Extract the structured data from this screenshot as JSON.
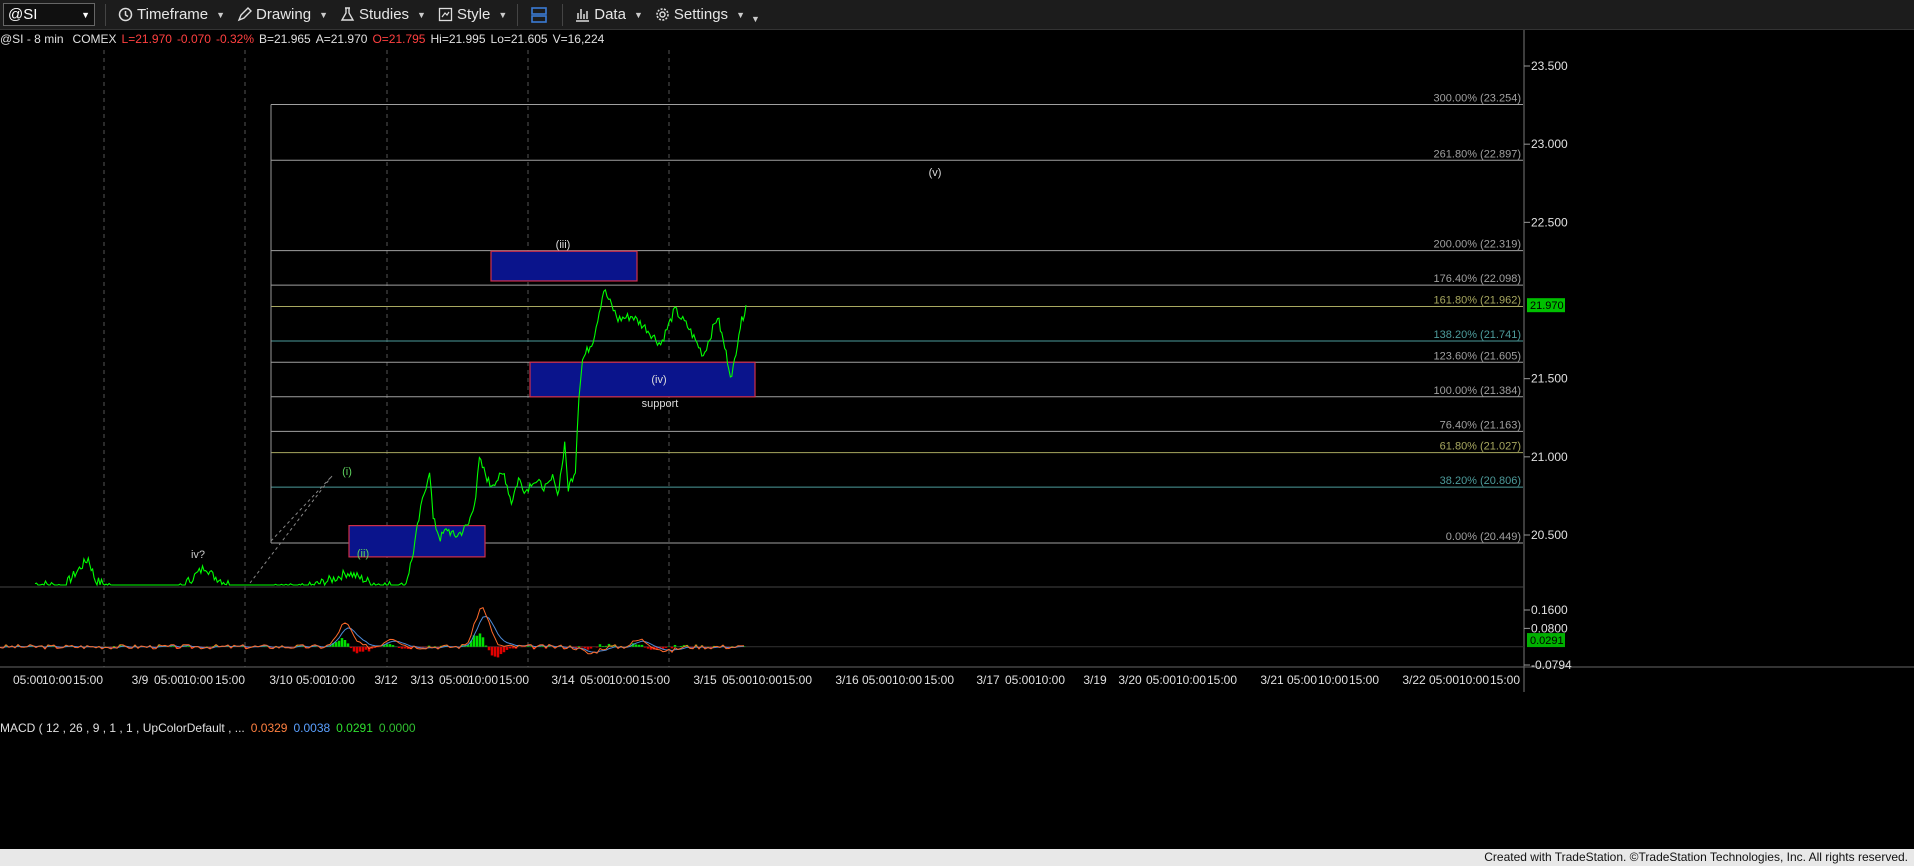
{
  "toolbar": {
    "symbol": "@SI",
    "timeframe": "Timeframe",
    "drawing": "Drawing",
    "studies": "Studies",
    "style": "Style",
    "data": "Data",
    "settings": "Settings"
  },
  "info": {
    "symbol": "@SI - 8 min",
    "exchange": "COMEX",
    "last": "L=21.970",
    "change": "-0.070",
    "pct": "-0.32%",
    "bid": "B=21.965",
    "ask": "A=21.970",
    "open": "O=21.795",
    "high": "Hi=21.995",
    "low": "Lo=21.605",
    "volume": "V=16,224"
  },
  "macd_legend": {
    "label": "MACD ( 12 , 26 , 9 , 1 , 1 , UpColorDefault , ...",
    "v1": "0.0329",
    "v2": "0.0038",
    "v3": "0.0291",
    "v4": "0.0000"
  },
  "footer": "Created with TradeStation. ©TradeStation Technologies, Inc. All rights reserved.",
  "colors": {
    "price_line": "#00ff00",
    "box_fill": "#0a148c",
    "box_border": "#d0304a",
    "macd_line": "#ff6a2a",
    "signal_line": "#4d8bd8",
    "hist_up": "#00e000",
    "hist_down": "#e00000"
  },
  "chart_data": {
    "type": "line",
    "symbol": "@SI",
    "interval": "8 min",
    "price_axis": {
      "ticks": [
        "23.500",
        "23.000",
        "22.500",
        "21.500",
        "21.000",
        "20.500"
      ],
      "tick_values": [
        23.5,
        23.0,
        22.5,
        21.5,
        21.0,
        20.5
      ],
      "last_price": "21.970"
    },
    "macd_axis": {
      "ticks": [
        "0.1600",
        "0.0800",
        "-0.0794"
      ],
      "tick_values": [
        0.16,
        0.08,
        -0.0794
      ],
      "last_value": "0.0291"
    },
    "time_labels": [
      "05:00",
      "10:00",
      "15:00",
      "3/9",
      "05:00",
      "10:00",
      "15:00",
      "3/10",
      "05:00",
      "10:00",
      "3/12",
      "3/13",
      "05:00",
      "10:00",
      "15:00",
      "3/14",
      "05:00",
      "10:00",
      "15:00",
      "3/15",
      "05:00",
      "10:00",
      "15:00",
      "3/16",
      "05:00",
      "10:00",
      "15:00",
      "3/17",
      "05:00",
      "10:00",
      "3/19",
      "3/20",
      "05:00",
      "10:00",
      "15:00",
      "3/21",
      "05:00",
      "10:00",
      "15:00",
      "3/22",
      "05:00",
      "10:00",
      "15:00"
    ],
    "fib_levels": [
      {
        "label": "300.00% (23.254)",
        "value": 23.254,
        "color": "#a0a0a0"
      },
      {
        "label": "261.80% (22.897)",
        "value": 22.897,
        "color": "#a0a0a0"
      },
      {
        "label": "200.00% (22.319)",
        "value": 22.319,
        "color": "#a0a0a0"
      },
      {
        "label": "176.40% (22.098)",
        "value": 22.098,
        "color": "#a0a0a0"
      },
      {
        "label": "161.80% (21.962)",
        "value": 21.962,
        "color": "#a8a860"
      },
      {
        "label": "138.20% (21.741)",
        "value": 21.741,
        "color": "#4d9b9b"
      },
      {
        "label": "123.60% (21.605)",
        "value": 21.605,
        "color": "#a0a0a0"
      },
      {
        "label": "100.00% (21.384)",
        "value": 21.384,
        "color": "#a0a0a0"
      },
      {
        "label": "76.40% (21.163)",
        "value": 21.163,
        "color": "#a0a0a0"
      },
      {
        "label": "61.80% (21.027)",
        "value": 21.027,
        "color": "#a8a860"
      },
      {
        "label": "38.20% (20.806)",
        "value": 20.806,
        "color": "#4d9b9b"
      },
      {
        "label": "0.00% (20.449)",
        "value": 20.449,
        "color": "#a0a0a0"
      }
    ],
    "wave_labels": [
      "iv?",
      "(i)",
      "(ii)",
      "(iii)",
      "(iv)",
      "support",
      "(v)"
    ],
    "price_path": [
      [
        0.0,
        20.19
      ],
      [
        0.04,
        20.17
      ],
      [
        0.05,
        20.22
      ],
      [
        0.075,
        20.35
      ],
      [
        0.085,
        20.21
      ],
      [
        0.1,
        20.18
      ],
      [
        0.13,
        20.14
      ],
      [
        0.2,
        20.15
      ],
      [
        0.22,
        20.22
      ],
      [
        0.24,
        20.3
      ],
      [
        0.25,
        20.24
      ],
      [
        0.28,
        20.17
      ],
      [
        0.3,
        20.12
      ],
      [
        0.33,
        20.16
      ],
      [
        0.38,
        20.16
      ],
      [
        0.42,
        20.22
      ],
      [
        0.44,
        20.26
      ],
      [
        0.47,
        20.2
      ],
      [
        0.49,
        20.18
      ],
      [
        0.52,
        20.17
      ],
      [
        0.53,
        20.34
      ],
      [
        0.54,
        20.6
      ],
      [
        0.545,
        20.72
      ],
      [
        0.55,
        20.82
      ],
      [
        0.555,
        20.92
      ],
      [
        0.56,
        20.6
      ],
      [
        0.57,
        20.48
      ],
      [
        0.58,
        20.54
      ],
      [
        0.59,
        20.49
      ],
      [
        0.6,
        20.52
      ],
      [
        0.61,
        20.57
      ],
      [
        0.62,
        20.75
      ],
      [
        0.625,
        20.98
      ],
      [
        0.64,
        20.82
      ],
      [
        0.66,
        20.89
      ],
      [
        0.67,
        20.71
      ],
      [
        0.68,
        20.86
      ],
      [
        0.69,
        20.78
      ],
      [
        0.7,
        20.85
      ],
      [
        0.72,
        20.8
      ],
      [
        0.73,
        20.88
      ],
      [
        0.735,
        20.75
      ],
      [
        0.745,
        21.07
      ],
      [
        0.75,
        20.8
      ],
      [
        0.76,
        20.92
      ],
      [
        0.765,
        21.4
      ],
      [
        0.77,
        21.62
      ],
      [
        0.785,
        21.75
      ],
      [
        0.8,
        22.07
      ],
      [
        0.82,
        21.88
      ],
      [
        0.84,
        21.9
      ],
      [
        0.86,
        21.82
      ],
      [
        0.88,
        21.72
      ],
      [
        0.9,
        21.94
      ],
      [
        0.92,
        21.82
      ],
      [
        0.94,
        21.65
      ],
      [
        0.96,
        21.9
      ],
      [
        0.97,
        21.7
      ],
      [
        0.98,
        21.5
      ],
      [
        0.99,
        21.8
      ],
      [
        1.0,
        21.97
      ]
    ],
    "zone_boxes": [
      {
        "name": "wave-iii-target",
        "x_from": "3/14 00:00",
        "x_to": "3/14 15:00",
        "y_low": 22.125,
        "y_high": 22.315
      },
      {
        "name": "wave-iv-support",
        "x_from": "3/14 03:00",
        "x_to": "3/15 10:00",
        "y_low": 21.384,
        "y_high": 21.605
      },
      {
        "name": "wave-ii-support",
        "x_from": "3/11 10:00",
        "x_to": "3/13 05:00",
        "y_low": 20.36,
        "y_high": 20.56
      }
    ]
  }
}
